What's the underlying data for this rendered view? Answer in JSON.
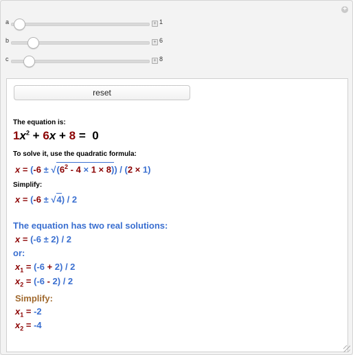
{
  "sliders": [
    {
      "label": "a",
      "value": "1",
      "fraction": 0.05
    },
    {
      "label": "b",
      "value": "6",
      "fraction": 0.15
    },
    {
      "label": "c",
      "value": "8",
      "fraction": 0.12
    }
  ],
  "reset_label": "reset",
  "equation_heading": "The equation is:",
  "equation": {
    "a": "1",
    "x": "x",
    "exp": "2",
    "plus1": " + ",
    "b": "6",
    "x2": "x",
    "plus2": " + ",
    "c": "8",
    "rest": " =  0"
  },
  "solve_heading": "To solve it, use the quadratic formula:",
  "quad": {
    "lhs": "x = ",
    "open": "(",
    "neg_b": "-6",
    "pm": " ± ",
    "radicand_open": "(",
    "b_sq_base": "6",
    "b_sq_exp": "2",
    "minus4": " - 4 ",
    "times1": "× ",
    "a": "1",
    "times2": " × ",
    "c": "8",
    "radicand_close": ")",
    "close": ") / (",
    "two": "2",
    "times3": " × ",
    "a2": "1",
    "close2": ")"
  },
  "simplify_heading": "Simplify:",
  "simplified": {
    "lhs": "x = ",
    "open": "(",
    "neg_b": "-6",
    "pm": " ± ",
    "disc": "4",
    "close": ") / ",
    "den": "2"
  },
  "two_solutions": "The equation has two real solutions:",
  "pm_line": {
    "lhs": "x = ",
    "expr": "(-6 ± 2) / 2"
  },
  "or_label": "or:",
  "x1_line": {
    "var": "x",
    "sub": "1",
    "eq": " = ",
    "expr_open": "(-6 ",
    "plus": "+",
    "expr_close": " 2) / 2"
  },
  "x2_line": {
    "var": "x",
    "sub": "2",
    "eq": " = ",
    "expr_open": "(-6 ",
    "minus": "-",
    "expr_close": " 2) / 2"
  },
  "simplify2": "Simplify:",
  "x1_result": {
    "var": "x",
    "sub": "1",
    "eq": " = ",
    "val": "-2"
  },
  "x2_result": {
    "var": "x",
    "sub": "2",
    "eq": " = ",
    "val": "-4"
  },
  "colors": {
    "coef": "#8b0000",
    "accent": "#3a6fd0",
    "simplify": "#a0692e"
  }
}
